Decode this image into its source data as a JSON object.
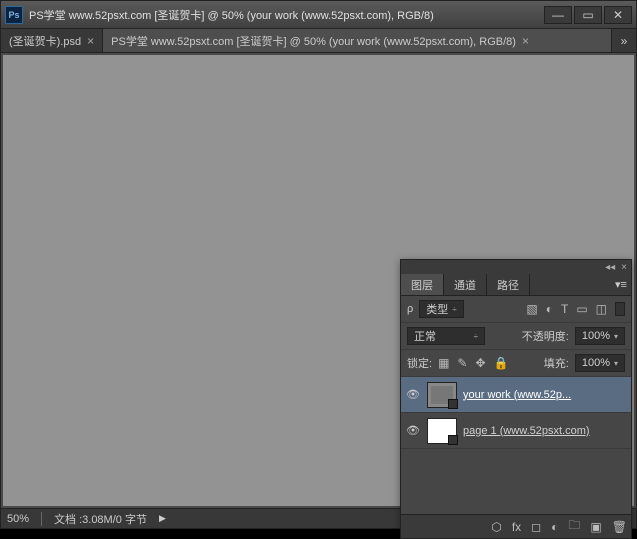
{
  "titlebar": {
    "app_icon": "Ps",
    "title": "PS学堂 www.52psxt.com [圣诞贺卡] @ 50% (your work (www.52psxt.com), RGB/8)"
  },
  "doc_tabs": {
    "inactive": {
      "label": "(圣诞贺卡).psd"
    },
    "active": {
      "label": "PS学堂 www.52psxt.com [圣诞贺卡] @ 50% (your work (www.52psxt.com), RGB/8)"
    }
  },
  "statusbar": {
    "zoom": "50%",
    "docinfo": "文档 :3.08M/0 字节"
  },
  "panel": {
    "tabs": {
      "layers": "图层",
      "channels": "通道",
      "paths": "路径"
    },
    "filter_row": {
      "kind_label": "类型"
    },
    "blend_row": {
      "mode": "正常",
      "opacity_label": "不透明度:",
      "opacity_value": "100%"
    },
    "lock_row": {
      "lock_label": "锁定:",
      "fill_label": "填充:",
      "fill_value": "100%"
    },
    "layers": [
      {
        "name": "your work (www.52p...",
        "selected": true,
        "thumb": "gray"
      },
      {
        "name": "page 1 (www.52psxt.com)",
        "selected": false,
        "thumb": "white"
      }
    ]
  }
}
